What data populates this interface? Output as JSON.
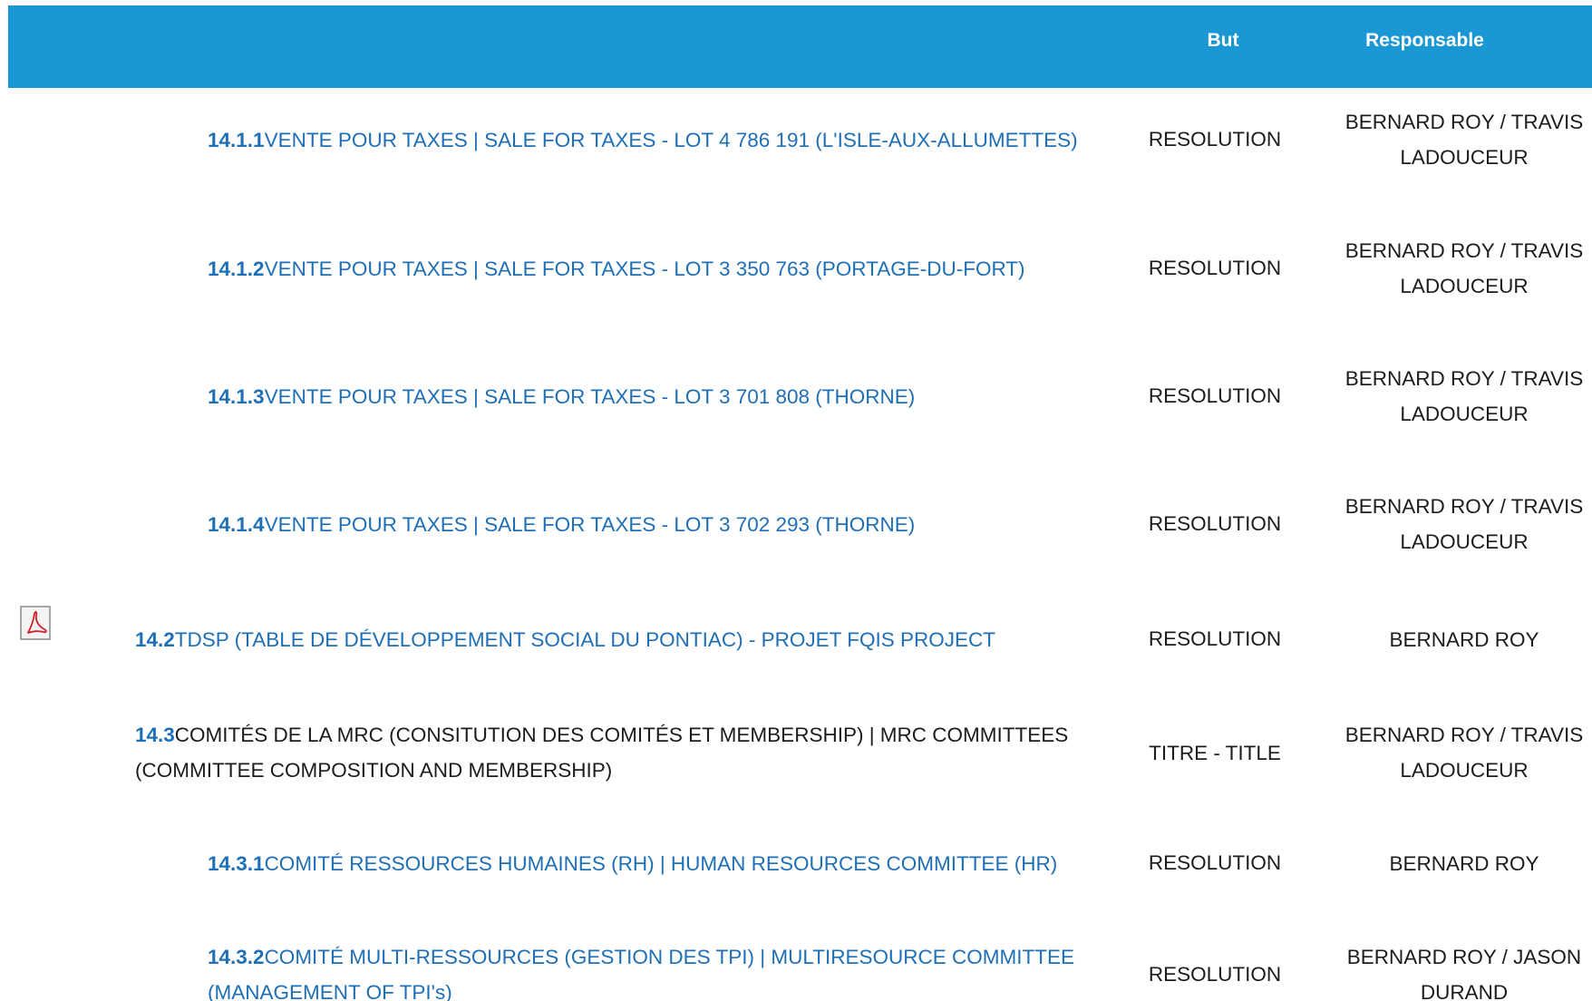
{
  "table": {
    "headers": {
      "title": "",
      "purpose": "But",
      "responsible": "Responsable"
    },
    "rows": [
      {
        "number": "14.1.1",
        "title": "VENTE POUR TAXES | SALE FOR TAXES - LOT 4 786 191 (L'ISLE-AUX-ALLUMETTES)",
        "purpose": "RESOLUTION",
        "responsible": "BERNARD ROY / TRAVIS LADOUCEUR",
        "has_attachment": false
      },
      {
        "number": "14.1.2",
        "title": "VENTE POUR TAXES | SALE FOR TAXES - LOT 3 350 763 (PORTAGE-DU-FORT)",
        "purpose": "RESOLUTION",
        "responsible": "BERNARD ROY / TRAVIS LADOUCEUR",
        "has_attachment": false
      },
      {
        "number": "14.1.3",
        "title": "VENTE POUR TAXES | SALE FOR TAXES - LOT 3 701 808 (THORNE)",
        "purpose": "RESOLUTION",
        "responsible": "BERNARD ROY / TRAVIS LADOUCEUR",
        "has_attachment": false
      },
      {
        "number": "14.1.4",
        "title": "VENTE POUR TAXES | SALE FOR TAXES - LOT 3 702 293 (THORNE)",
        "purpose": "RESOLUTION",
        "responsible": "BERNARD ROY / TRAVIS LADOUCEUR",
        "has_attachment": false
      },
      {
        "number": "14.2",
        "title": "TDSP (TABLE DE DÉVELOPPEMENT SOCIAL DU PONTIAC) - PROJET FQIS PROJECT",
        "purpose": "RESOLUTION",
        "responsible": "BERNARD ROY",
        "has_attachment": true,
        "attachment_icon": "pdf-icon"
      },
      {
        "number": "14.3",
        "title": "COMITÉS DE LA MRC (CONSITUTION DES COMITÉS ET MEMBERSHIP) | MRC COMMITTEES (COMMITTEE COMPOSITION AND MEMBERSHIP)",
        "purpose": "TITRE - TITLE",
        "responsible": "BERNARD ROY / TRAVIS LADOUCEUR",
        "has_attachment": false
      },
      {
        "number": "14.3.1",
        "title": "COMITÉ RESSOURCES HUMAINES (RH) | HUMAN RESOURCES COMMITTEE (HR)",
        "purpose": "RESOLUTION",
        "responsible": "BERNARD ROY",
        "has_attachment": false
      },
      {
        "number": "14.3.2",
        "title": "COMITÉ MULTI-RESSOURCES (GESTION DES TPI) | MULTIRESOURCE COMMITTEE (MANAGEMENT OF TPI's)",
        "purpose": "RESOLUTION",
        "responsible": "BERNARD ROY / JASON DURAND",
        "has_attachment": false
      }
    ]
  },
  "colors": {
    "header_bg": "#1b98d4",
    "link": "#1f6fb6",
    "text": "#1c1c1c",
    "pdf_red": "#d0222a"
  }
}
